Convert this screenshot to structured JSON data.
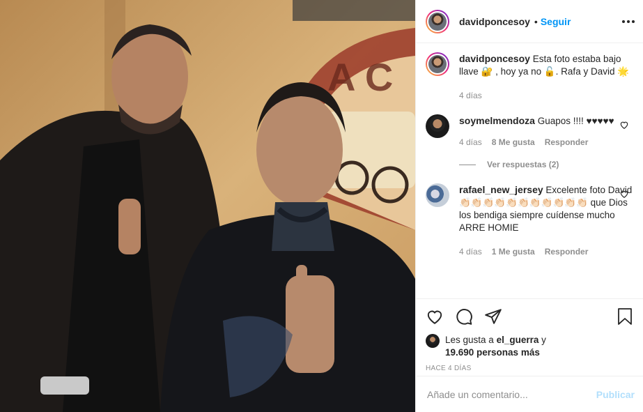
{
  "post": {
    "username": "davidponcesoy",
    "follow_label": "Seguir"
  },
  "caption": {
    "username": "davidponcesoy",
    "text": "Esta foto estaba bajo llave 🔐 , hoy ya no 🔓. Rafa y David 🌟",
    "time": "4 días"
  },
  "comments": [
    {
      "username": "soymelmendoza",
      "text": "Guapos !!!! ♥♥♥♥♥",
      "time": "4 días",
      "likes": "8 Me gusta",
      "reply_label": "Responder",
      "view_replies": "Ver respuestas (2)"
    },
    {
      "username": "rafael_new_jersey",
      "text": "Excelente foto David👏🏻👏🏻👏🏻👏🏻👏🏻👏🏻👏🏻👏🏻👏🏻👏🏻👏🏻 que Dios los bendiga siempre cuídense mucho ARRE HOMIE",
      "time": "4 días",
      "likes": "1 Me gusta",
      "reply_label": "Responder"
    }
  ],
  "likes": {
    "prefix": "Les gusta a",
    "user": "el_guerra",
    "joiner": "y",
    "count": "19.690 personas más"
  },
  "posted": "HACE 4 DÍAS",
  "comment_box": {
    "placeholder": "Añade un comentario...",
    "publish_label": "Publicar"
  },
  "icons": [
    "heart-icon",
    "comment-icon",
    "share-icon",
    "bookmark-icon"
  ]
}
